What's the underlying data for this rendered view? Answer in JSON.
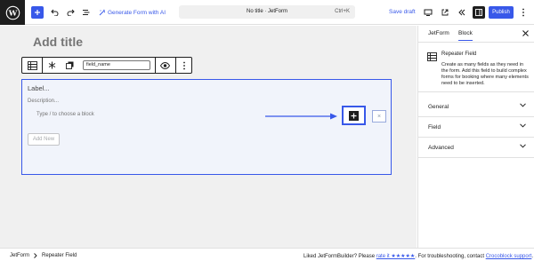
{
  "toolbar": {
    "add_block_label": "Toggle block inserter",
    "generate_form_label": "Generate Form with AI",
    "document_title": "No title · JetForm",
    "document_shortcut": "Ctrl+K",
    "save_draft_label": "Save draft",
    "publish_label": "Publish"
  },
  "editor": {
    "title_placeholder": "Add title"
  },
  "block_toolbar": {
    "field_name_value": "field_name"
  },
  "repeater": {
    "label_placeholder": "Label...",
    "description_placeholder": "Description...",
    "inner_placeholder": "Type / to choose a block",
    "remove_label": "×",
    "add_new_label": "Add New"
  },
  "sidebar": {
    "tabs": [
      {
        "label": "JetForm",
        "active": false
      },
      {
        "label": "Block",
        "active": true
      }
    ],
    "block_card": {
      "title": "Repeater Field",
      "description": "Create as many fields as they need in the form. Add this field to build complex forms for booking where many elements need to be inserted."
    },
    "panels": [
      {
        "label": "General"
      },
      {
        "label": "Field"
      },
      {
        "label": "Advanced"
      }
    ]
  },
  "footer": {
    "breadcrumbs": [
      "JetForm",
      "Repeater Field"
    ],
    "msg_prefix": "Liked JetFormBuilder? Please ",
    "rate_link": "rate it ★★★★★",
    "msg_middle": ". For troubleshooting, contact ",
    "support_link": "Crocoblock support",
    "msg_suffix": "."
  },
  "colors": {
    "accent": "#3858e9",
    "dark": "#1e1e1e",
    "canvas": "#f0f0f0",
    "repeater_bg": "#f1f4fb"
  }
}
